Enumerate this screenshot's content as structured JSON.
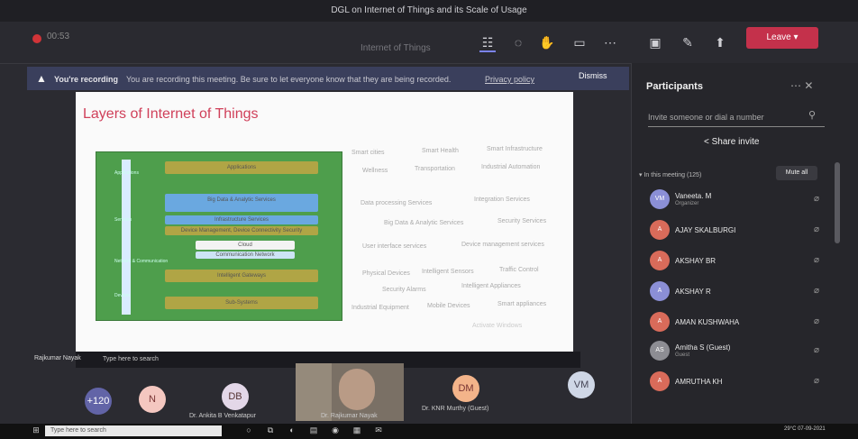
{
  "window": {
    "title": "DGL on Internet of Things and its Scale of Usage"
  },
  "toolbar": {
    "timer": "00:53",
    "meeting_name": "Internet of Things",
    "leave_label": "Leave"
  },
  "banner": {
    "title": "You're recording",
    "message": "You are recording this meeting. Be sure to let everyone know that they are being recorded.",
    "privacy_link": "Privacy policy",
    "dismiss_label": "Dismiss"
  },
  "slide": {
    "title": "Layers of Internet of Things",
    "layers": [
      "Applications",
      "Big Data & Analytic Services",
      "Infrastructure Services",
      "Device Management, Device Connectivity Security",
      "Cloud",
      "Communication Network",
      "Intelligent Gateways",
      "Sub-Systems"
    ],
    "side_labels": [
      "Applications",
      "Services",
      "Network & Communication",
      "Devices"
    ],
    "categories": [
      [
        "Smart cities",
        "Smart Health",
        "Smart Infrastructure"
      ],
      [
        "Wellness",
        "Transportation",
        "Industrial Automation"
      ],
      [
        "Data processing Services",
        "Integration Services"
      ],
      [
        "Big Data & Analytic Services",
        "Security Services"
      ],
      [
        "User interface services",
        "Device management services"
      ],
      [
        "Physical Devices",
        "Intelligent Sensors",
        "Traffic Control"
      ],
      [
        "Security Alarms",
        "Intelligent Appliances"
      ],
      [
        "Industrial Equipment",
        "Mobile Devices",
        "Smart appliances"
      ]
    ],
    "activate_windows": "Activate Windows"
  },
  "inner_taskbar": {
    "presenter_label": "Rajkumar Nayak",
    "search_placeholder": "Type here to search"
  },
  "gallery": {
    "overflow_count": "+120",
    "tiles": [
      {
        "initials": "N",
        "color": "#f4c7c0"
      },
      {
        "initials": "DB",
        "color": "#e3d7e8"
      },
      {
        "initials": "DM",
        "color": "#f3b48a"
      },
      {
        "initials": "VM",
        "color": "#cfd7e6"
      }
    ],
    "names": [
      "Dr. Ankita B Venkatapur",
      "Dr. Rajkumar Nayak",
      "Dr. KNR Murthy (Guest)"
    ]
  },
  "participants": {
    "title": "Participants",
    "invite_placeholder": "Invite someone or dial a number",
    "share_invite": "Share invite",
    "in_meeting": "In this meeting (125)",
    "mute_all": "Mute all",
    "list": [
      {
        "initials": "VM",
        "name": "Vaneeta. M",
        "role": "Organizer",
        "color": "#8b8fd6"
      },
      {
        "initials": "A",
        "name": "AJAY SKALBURGI",
        "role": "",
        "color": "#d96b5a"
      },
      {
        "initials": "A",
        "name": "AKSHAY BR",
        "role": "",
        "color": "#d96b5a"
      },
      {
        "initials": "A",
        "name": "AKSHAY R",
        "role": "",
        "color": "#8b8fd6"
      },
      {
        "initials": "A",
        "name": "AMAN KUSHWAHA",
        "role": "",
        "color": "#d96b5a"
      },
      {
        "initials": "AS",
        "name": "Amitha S (Guest)",
        "role": "Guest",
        "color": "#8d8d93"
      },
      {
        "initials": "A",
        "name": "AMRUTHA KH",
        "role": "",
        "color": "#d96b5a"
      }
    ]
  },
  "taskbar": {
    "search_placeholder": "Type here to search",
    "time": "29°C",
    "clock": "07-09-2021"
  }
}
